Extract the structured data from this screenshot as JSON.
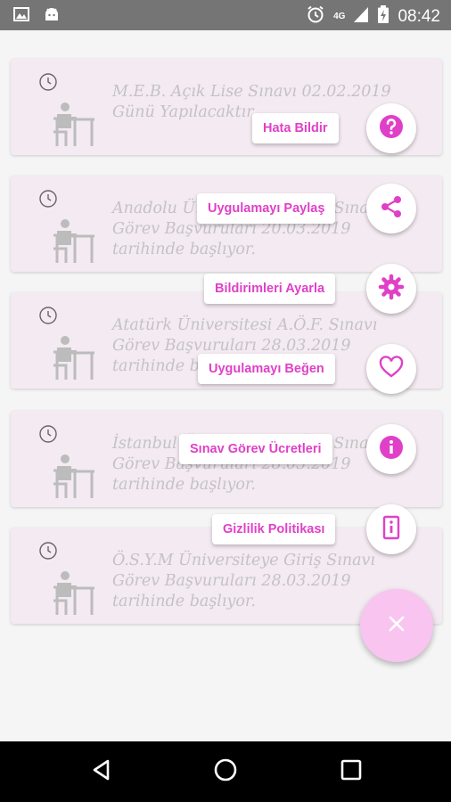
{
  "status_bar": {
    "time": "08:42",
    "network_type": "4G",
    "icons": [
      "image-icon",
      "android-icon",
      "alarm-icon",
      "signal-icon",
      "battery-icon"
    ]
  },
  "cards": [
    {
      "text": "M.E.B. Açık Lise Sınavı 02.02.2019 Günü Yapılacaktır."
    },
    {
      "text": "Anadolu Üniversitesi A.Ö.F. Sınav Görev Başvuruları 20.03.2019 tarihinde başlıyor."
    },
    {
      "text": "Atatürk Üniversitesi A.Ö.F. Sınavı Görev Başvuruları 28.03.2019 tarihinde başlıyor."
    },
    {
      "text": "İstanbul Üniversitesi A.Ö.F. Sınav Görev Başvuruları 28.03.2019 tarihinde başlıyor."
    },
    {
      "text": "Ö.S.Y.M Üniversiteye Giriş Sınavı Görev Başvuruları 28.03.2019 tarihinde başlıyor."
    }
  ],
  "fab_menu": {
    "items": [
      {
        "label": "Hata Bildir",
        "icon": "help-icon"
      },
      {
        "label": "Uygulamayı Paylaş",
        "icon": "share-icon"
      },
      {
        "label": "Bildirimleri Ayarla",
        "icon": "gear-icon"
      },
      {
        "label": "Uygulamayı Beğen",
        "icon": "heart-icon"
      },
      {
        "label": "Sınav Görev Ücretleri",
        "icon": "info-icon"
      },
      {
        "label": "Gizlilik Politikası",
        "icon": "document-icon"
      }
    ],
    "main_icon": "close-icon"
  },
  "colors": {
    "accent": "#e040c8",
    "card_bg": "#f3e8f1",
    "fab_bg": "#f9c4ef",
    "card_text": "#bdbdbd",
    "status_bar": "#757575"
  },
  "nav_bar": {
    "icons": [
      "back-icon",
      "home-icon",
      "recents-icon"
    ]
  }
}
